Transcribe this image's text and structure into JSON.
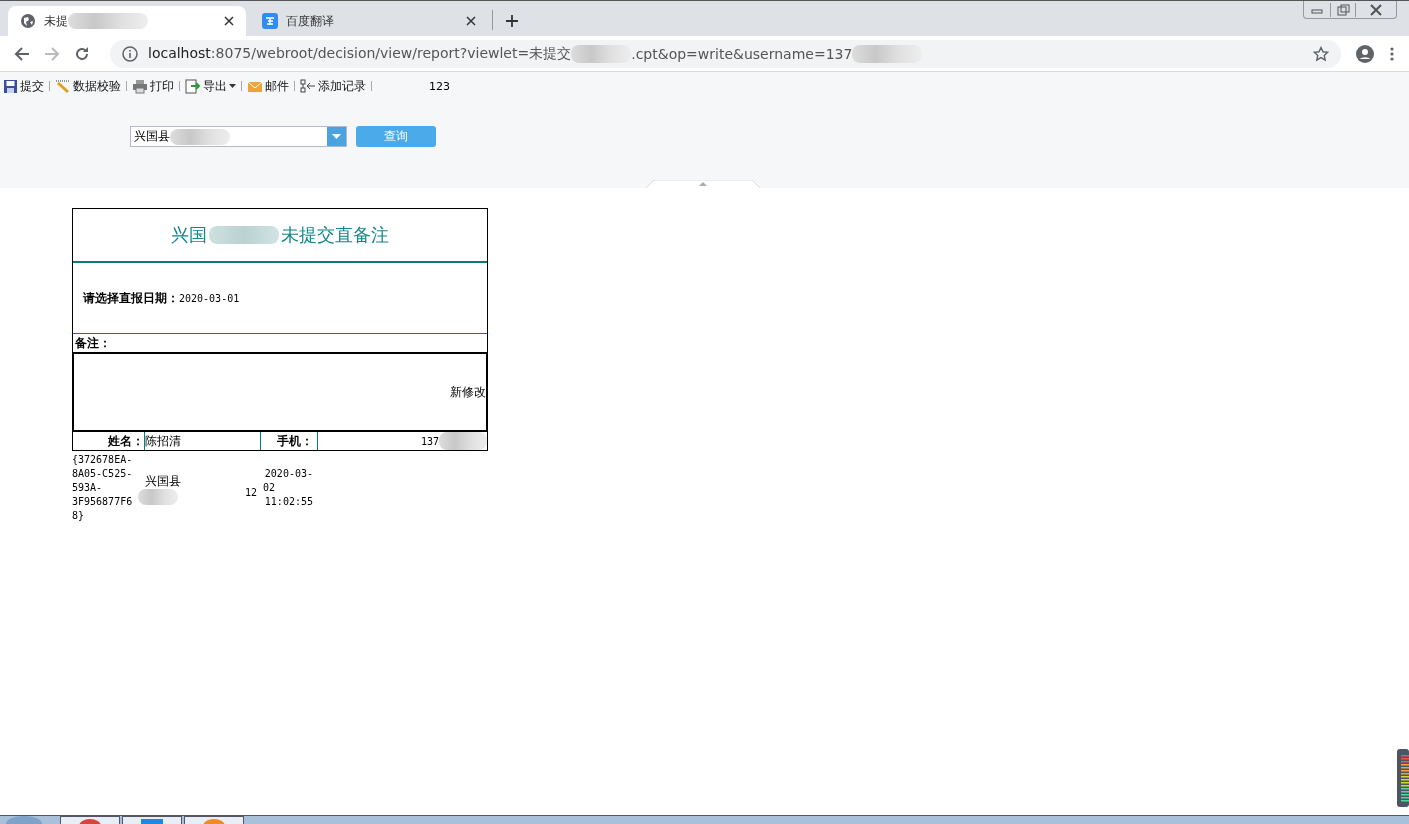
{
  "tabs": [
    {
      "title": "未提",
      "selected": true,
      "kind": "globe"
    },
    {
      "title": "百度翻译",
      "selected": false,
      "kind": "translate"
    }
  ],
  "address": {
    "host": "localhost",
    "rest": ":8075/webroot/decision/view/report?viewlet=未提交",
    "tail": ".cpt&op=write&username=137"
  },
  "toolbar": [
    {
      "label": "提交",
      "kind": "save"
    },
    {
      "label": "数据校验",
      "kind": "check"
    },
    {
      "label": "打印",
      "kind": "print"
    },
    {
      "label": "导出",
      "kind": "export"
    },
    {
      "label": "邮件",
      "kind": "mail"
    },
    {
      "label": "添加记录",
      "kind": "add"
    }
  ],
  "toolbar_page": "123",
  "params": {
    "county": "兴国县",
    "button": "查询"
  },
  "report": {
    "title_start": "兴国",
    "title_end": "未提交直备注",
    "date_label": "请选择直报日期：",
    "date": "2020-03-01",
    "remark_label": "备注：",
    "remark": "新修改",
    "name_label": "姓名：",
    "name": "陈招清",
    "phone_label": "手机：",
    "phone": "137",
    "record": {
      "id_lines": [
        "{372678EA-",
        "8A05-C525-",
        "593A-",
        "3F956877F6",
        "8}"
      ],
      "county": "兴国县",
      "number": "12",
      "date_lines": [
        "2020-03-",
        "02",
        "11:02:55"
      ]
    }
  }
}
